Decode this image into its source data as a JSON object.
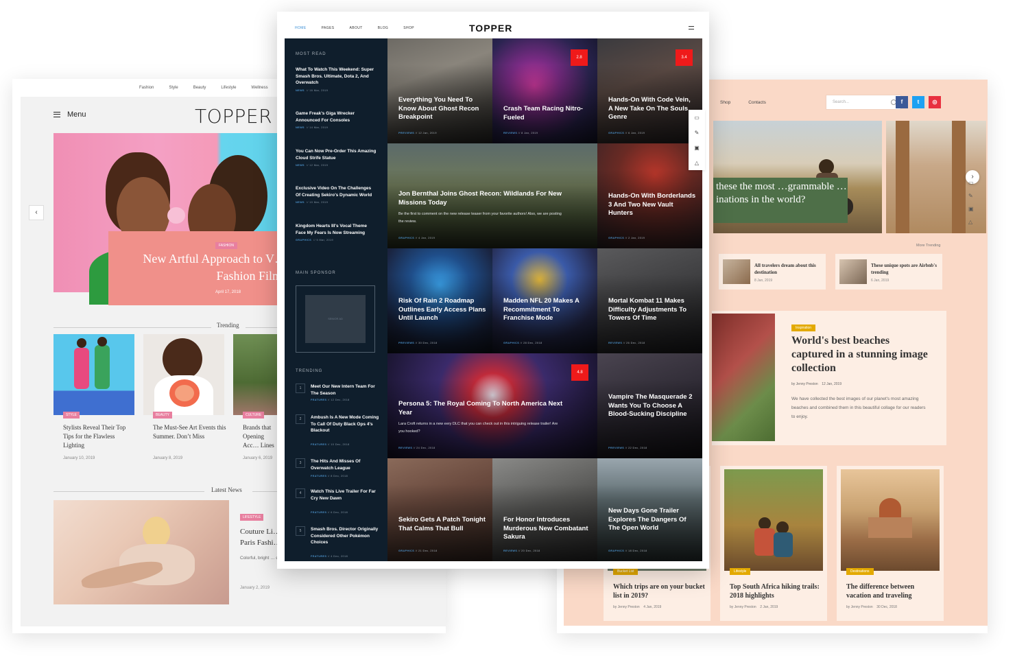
{
  "left": {
    "topnav": [
      "Fashion",
      "Style",
      "Beauty",
      "Lifestyle",
      "Wellness"
    ],
    "menu_label": "Menu",
    "logo": "TOPPER",
    "hero": {
      "tag": "FASHION",
      "title": "New Artful Approach to V… Fashion Films",
      "date": "April 17, 2018"
    },
    "trending_heading": "Trending",
    "trending": [
      {
        "tag": "STYLE",
        "title": "Stylists Reveal Their Top Tips for the Flawless Lighting",
        "date": "January 10, 2019"
      },
      {
        "tag": "BEAUTY",
        "title": "The Must-See Art Events this Summer. Don’t Miss",
        "date": "January 8, 2019"
      },
      {
        "tag": "CULTURE",
        "title": "Brands that Opening Acc… Lines",
        "date": "January 6, 2019"
      }
    ],
    "latest_heading": "Latest News",
    "latest": {
      "tag": "LIFESTYLE",
      "title": "Couture Li… Paris Fashi…",
      "body": "Colorful, bright … designers from … feedback from critics.",
      "date": "January 2, 2019"
    }
  },
  "right": {
    "nav": [
      "Shop",
      "Contacts"
    ],
    "search_placeholder": "Search...",
    "social": [
      {
        "icon": "facebook-icon",
        "glyph": "f",
        "color": "#3b5998"
      },
      {
        "icon": "twitter-icon",
        "glyph": "t",
        "color": "#1da1f2"
      },
      {
        "icon": "instagram-icon",
        "glyph": "◎",
        "color": "#e8303f"
      }
    ],
    "slide_caption": "these the most …grammable …inations in the world?",
    "more_trending": "More Trending",
    "minis": [
      {
        "title": "All travelers dream about this destination",
        "date": "8 Jan, 2019"
      },
      {
        "title": "These unique spots are Airbnb's trending",
        "date": "6 Jan, 2019"
      }
    ],
    "feature": {
      "tag": "Inspiration",
      "title": "World's best beaches captured in a stunning image collection",
      "by": "by Jenny Preston",
      "date": "12 Jan, 2019",
      "body": "We have collected the best images of our planet's most amazing beaches and combined them in this beautiful collage for our readers to enjoy."
    },
    "cards": [
      {
        "tag": "Bucket List",
        "title": "Which trips are on your bucket list in 2019?",
        "by": "by Jenny Preston",
        "date": "4 Jan, 2019"
      },
      {
        "tag": "Lifestyle",
        "title": "Top South Africa hiking trails: 2018 highlights",
        "by": "by Jenny Preston",
        "date": "2 Jan, 2019"
      },
      {
        "tag": "Destinations",
        "title": "The difference between vacation and traveling",
        "by": "by Jenny Preston",
        "date": "30 Dec, 2018"
      }
    ]
  },
  "center": {
    "nav": [
      "HOME",
      "PAGES",
      "ABOUT",
      "BLOG",
      "SHOP"
    ],
    "logo": "TOPPER",
    "most_read_heading": "MOST READ",
    "most_read": [
      {
        "title": "What To Watch This Weekend: Super Smash Bros. Ultimate, Dota 2, And Overwatch",
        "cat": "NEWS",
        "date": "16 Mar, 2019"
      },
      {
        "title": "Game Freak's Giga Wrecker Announced For Consoles",
        "cat": "NEWS",
        "date": "14 Mar, 2019"
      },
      {
        "title": "You Can Now Pre-Order This Amazing Cloud Strife Statue",
        "cat": "NEWS",
        "date": "12 Mar, 2019"
      },
      {
        "title": "Exclusive Video On The Challenges Of Creating Sekiro's Dynamic World",
        "cat": "NEWS",
        "date": "10 Mar, 2019"
      },
      {
        "title": "Kingdom Hearts III's Vocal Theme Face My Fears Is Now Streaming",
        "cat": "GRAPHICS",
        "date": "5 Mar, 2019"
      }
    ],
    "sponsor_heading": "MAIN SPONSOR",
    "sponsor_label": "SENIOR AD",
    "trending_heading": "TRENDING",
    "trending": [
      {
        "num": "1",
        "title": "Meet Our New Intern Team For The Season",
        "cat": "FEATURES",
        "date": "12 Dec, 2018"
      },
      {
        "num": "2",
        "title": "Ambush Is A New Mode Coming To Call Of Duty Black Ops 4's Blackout",
        "cat": "FEATURES",
        "date": "10 Dec, 2018"
      },
      {
        "num": "3",
        "title": "The Hits And Misses Of Overwatch League",
        "cat": "FEATURES",
        "date": "8 Dec, 2018"
      },
      {
        "num": "4",
        "title": "Watch This Live Trailer For Far Cry New Dawn",
        "cat": "FEATURES",
        "date": "6 Dec, 2018"
      },
      {
        "num": "5",
        "title": "Smash Bros. Director Originally Considered Other Pokémon Choices",
        "cat": "FEATURES",
        "date": "4 Dec, 2018"
      }
    ],
    "tiles": [
      {
        "title": "Everything You Need To Know About Ghost Recon Breakpoint",
        "cat": "PREVIEWS",
        "date": "12 Jan, 2019"
      },
      {
        "title": "Crash Team Racing Nitro-Fueled",
        "cat": "REVIEWS",
        "date": "8 Jan, 2019",
        "score": "2.8"
      },
      {
        "title": "Hands-On With Code Vein, A New Take On The Souls Genre",
        "cat": "GRAPHICS",
        "date": "6 Jan, 2019",
        "score": "3.4"
      },
      {
        "title": "Jon Bernthal Joins Ghost Recon: Wildlands For New Missions Today",
        "excerpt": "Be the first to comment on the new release teaser from your favorite authors! Also, we are posting the review.",
        "cat": "GRAPHICS",
        "date": "4 Jan, 2019"
      },
      {
        "title": "Hands-On With Borderlands 3 And Two New Vault Hunters",
        "cat": "GRAPHICS",
        "date": "2 Jan, 2019"
      },
      {
        "title": "Risk Of Rain 2 Roadmap Outlines Early Access Plans Until Launch",
        "cat": "PREVIEWS",
        "date": "30 Dec, 2018"
      },
      {
        "title": "Madden NFL 20 Makes A Recommitment To Franchise Mode",
        "cat": "GRAPHICS",
        "date": "28 Dec, 2018"
      },
      {
        "title": "Mortal Kombat 11 Makes Difficulty Adjustments To Towers Of Time",
        "cat": "REVIEWS",
        "date": "26 Dec, 2018"
      },
      {
        "title": "Persona 5: The Royal Coming To North America Next Year",
        "excerpt": "Lara Croft returns in a new eery DLC that you can check out in this intriguing release trailer! Are you hooked?",
        "cat": "REVIEWS",
        "date": "24 Dec, 2018",
        "score": "4.8"
      },
      {
        "title": "Vampire The Masquerade 2 Wants You To Choose A Blood-Sucking Discipline",
        "cat": "PREVIEWS",
        "date": "22 Dec, 2018"
      },
      {
        "title": "Sekiro Gets A Patch Tonight That Calms That Bull",
        "cat": "GRAPHICS",
        "date": "21 Dec, 2018"
      },
      {
        "title": "For Honor Introduces Murderous New Combatant Sakura",
        "cat": "REVIEWS",
        "date": "20 Dec, 2018"
      },
      {
        "title": "New Days Gone Trailer Explores The Dangers Of The Open World",
        "cat": "GRAPHICS",
        "date": "18 Dec, 2018"
      }
    ],
    "tool_icons": [
      "monitor-icon",
      "edit-icon",
      "layers-icon",
      "bag-icon"
    ]
  }
}
